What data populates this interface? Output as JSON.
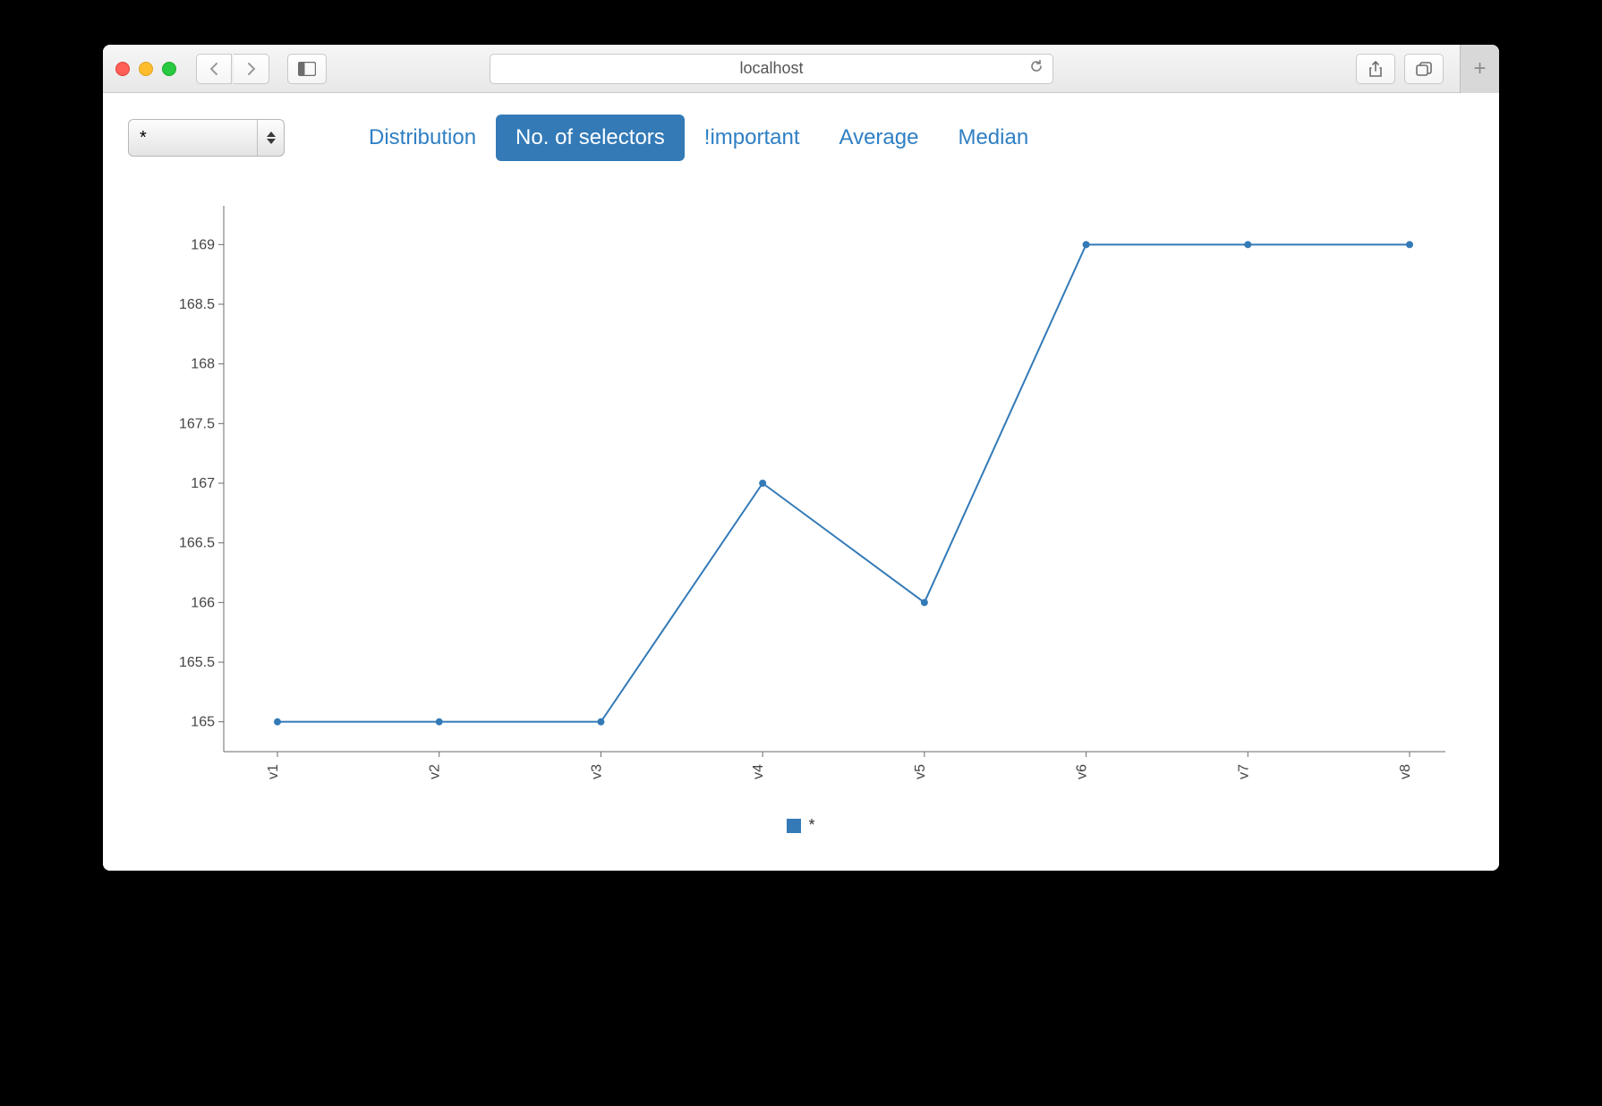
{
  "browser": {
    "address": "localhost"
  },
  "selector": {
    "value": "*"
  },
  "tabs": [
    {
      "label": "Distribution",
      "active": false
    },
    {
      "label": "No. of selectors",
      "active": true
    },
    {
      "label": "!important",
      "active": false
    },
    {
      "label": "Average",
      "active": false
    },
    {
      "label": "Median",
      "active": false
    }
  ],
  "legend": {
    "label": "*"
  },
  "chart_data": {
    "type": "line",
    "categories": [
      "v1",
      "v2",
      "v3",
      "v4",
      "v5",
      "v6",
      "v7",
      "v8"
    ],
    "series": [
      {
        "name": "*",
        "values": [
          165,
          165,
          165,
          167,
          166,
          169,
          169,
          169
        ]
      }
    ],
    "ylim": [
      164.75,
      169.25
    ],
    "yticks": [
      165,
      165.5,
      166,
      166.5,
      167,
      167.5,
      168,
      168.5,
      169
    ],
    "xlabel": "",
    "ylabel": "",
    "title": ""
  }
}
